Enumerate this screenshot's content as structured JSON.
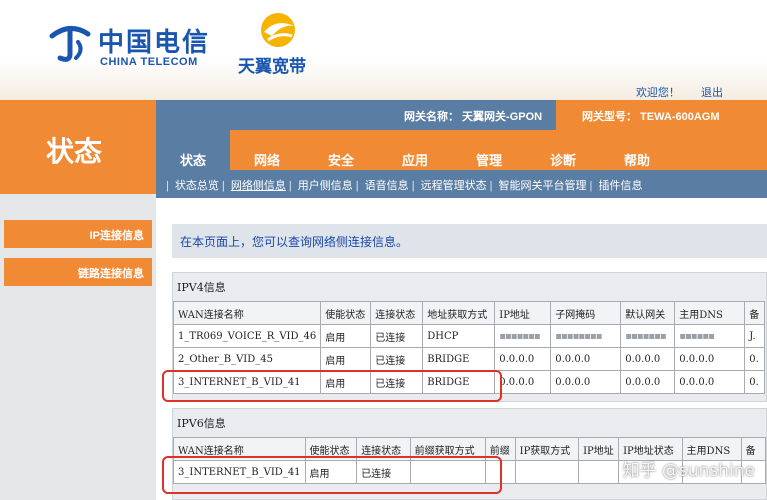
{
  "brand": {
    "telecom_cn": "中国电信",
    "telecom_en": "CHINA TELECOM",
    "broadband": "天翼宽带"
  },
  "user_links": {
    "welcome": "欢迎您！",
    "logout": "退出"
  },
  "page_title": "状态",
  "gateway": {
    "name_text": "网关名称：  天翼网关-GPON",
    "model_text": "网关型号：  TEWA-600AGM"
  },
  "menu": [
    "状态",
    "网络",
    "安全",
    "应用",
    "管理",
    "诊断",
    "帮助"
  ],
  "submenu": [
    "状态总览",
    "网络侧信息",
    "用户侧信息",
    "语音信息",
    "远程管理状态",
    "智能网关平台管理",
    "插件信息"
  ],
  "sidebar": [
    "IP连接信息",
    "链路连接信息"
  ],
  "intro": "在本页面上，您可以查询网络侧连接信息。",
  "ipv4": {
    "title": "IPV4信息",
    "headers": [
      "WAN连接名称",
      "使能状态",
      "连接状态",
      "地址获取方式",
      "IP地址",
      "子网掩码",
      "默认网关",
      "主用DNS",
      "备"
    ],
    "rows": [
      [
        "1_TR069_VOICE_R_VID_46",
        "启用",
        "已连接",
        "DHCP",
        "▪▪▪▪▪▪▪",
        "▪▪▪▪▪▪▪▪",
        "▪▪▪▪▪▪▪",
        "▪▪▪▪▪▪",
        "J."
      ],
      [
        "2_Other_B_VID_45",
        "启用",
        "已连接",
        "BRIDGE",
        "0.0.0.0",
        "0.0.0.0",
        "0.0.0.0",
        "0.0.0.0",
        "0."
      ],
      [
        "3_INTERNET_B_VID_41",
        "启用",
        "已连接",
        "BRIDGE",
        "0.0.0.0",
        "0.0.0.0",
        "0.0.0.0",
        "0.0.0.0",
        "0."
      ]
    ]
  },
  "ipv6": {
    "title": "IPV6信息",
    "headers": [
      "WAN连接名称",
      "使能状态",
      "连接状态",
      "前缀获取方式",
      "前缀",
      "IP获取方式",
      "IP地址",
      "IP地址状态",
      "主用DNS",
      "备"
    ],
    "rows": [
      [
        "3_INTERNET_B_VID_41",
        "启用",
        "已连接",
        "",
        "",
        "",
        "",
        "",
        "",
        ""
      ]
    ]
  },
  "watermark": "知乎 @sunshine",
  "colors": {
    "orange": "#f18a34",
    "blue": "#5a7ea3",
    "brand_blue": "#1a56b0",
    "highlight": "#e0302a"
  }
}
